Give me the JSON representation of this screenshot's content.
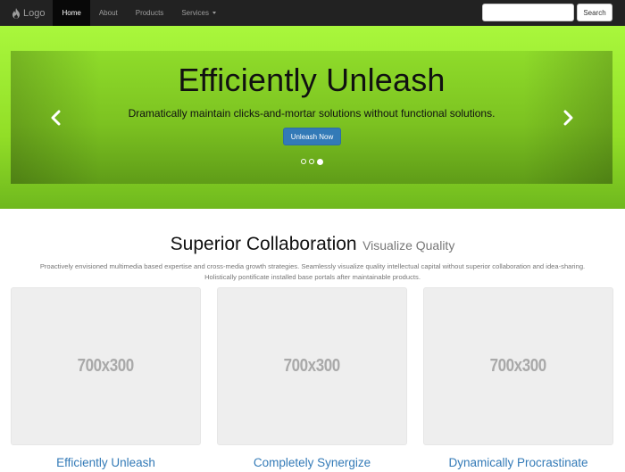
{
  "navbar": {
    "brand": "Logo",
    "brand_icon": "fire-icon",
    "items": [
      {
        "label": "Home",
        "active": true
      },
      {
        "label": "About"
      },
      {
        "label": "Products"
      },
      {
        "label": "Services",
        "dropdown": true
      }
    ],
    "search": {
      "value": "",
      "placeholder": ""
    },
    "search_button": "Search"
  },
  "hero": {
    "title": "Efficiently Unleash",
    "subtitle": "Dramatically maintain clicks-and-mortar solutions without functional solutions.",
    "button": "Unleash Now",
    "slides": 3,
    "active_slide": 3
  },
  "section": {
    "title": "Superior Collaboration",
    "title_small": "Visualize Quality",
    "lead_line1": "Proactively envisioned multimedia based expertise and cross-media growth strategies. Seamlessly visualize quality intellectual capital without superior collaboration and idea-sharing.",
    "lead_line2": "Holistically pontificate installed base portals after maintainable products."
  },
  "cards": [
    {
      "placeholder": "700x300",
      "title": "Efficiently Unleash"
    },
    {
      "placeholder": "700x300",
      "title": "Completely Synergize"
    },
    {
      "placeholder": "700x300",
      "title": "Dynamically Procrastinate"
    }
  ],
  "colors": {
    "navbar": "#222222",
    "hero_green": "#9be830",
    "primary": "#337ab7",
    "placeholder_bg": "#eeeeee"
  }
}
